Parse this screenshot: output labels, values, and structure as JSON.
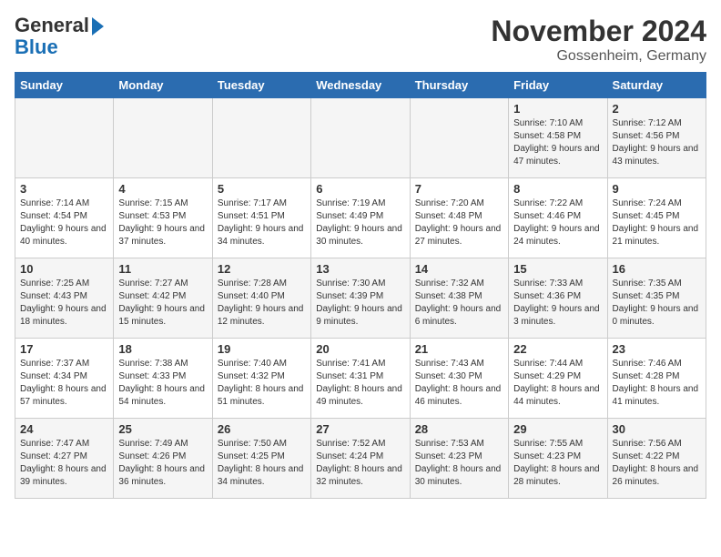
{
  "logo": {
    "line1": "General",
    "line2": "Blue"
  },
  "title": "November 2024",
  "location": "Gossenheim, Germany",
  "weekdays": [
    "Sunday",
    "Monday",
    "Tuesday",
    "Wednesday",
    "Thursday",
    "Friday",
    "Saturday"
  ],
  "weeks": [
    [
      {
        "day": "",
        "info": ""
      },
      {
        "day": "",
        "info": ""
      },
      {
        "day": "",
        "info": ""
      },
      {
        "day": "",
        "info": ""
      },
      {
        "day": "",
        "info": ""
      },
      {
        "day": "1",
        "info": "Sunrise: 7:10 AM\nSunset: 4:58 PM\nDaylight: 9 hours and 47 minutes."
      },
      {
        "day": "2",
        "info": "Sunrise: 7:12 AM\nSunset: 4:56 PM\nDaylight: 9 hours and 43 minutes."
      }
    ],
    [
      {
        "day": "3",
        "info": "Sunrise: 7:14 AM\nSunset: 4:54 PM\nDaylight: 9 hours and 40 minutes."
      },
      {
        "day": "4",
        "info": "Sunrise: 7:15 AM\nSunset: 4:53 PM\nDaylight: 9 hours and 37 minutes."
      },
      {
        "day": "5",
        "info": "Sunrise: 7:17 AM\nSunset: 4:51 PM\nDaylight: 9 hours and 34 minutes."
      },
      {
        "day": "6",
        "info": "Sunrise: 7:19 AM\nSunset: 4:49 PM\nDaylight: 9 hours and 30 minutes."
      },
      {
        "day": "7",
        "info": "Sunrise: 7:20 AM\nSunset: 4:48 PM\nDaylight: 9 hours and 27 minutes."
      },
      {
        "day": "8",
        "info": "Sunrise: 7:22 AM\nSunset: 4:46 PM\nDaylight: 9 hours and 24 minutes."
      },
      {
        "day": "9",
        "info": "Sunrise: 7:24 AM\nSunset: 4:45 PM\nDaylight: 9 hours and 21 minutes."
      }
    ],
    [
      {
        "day": "10",
        "info": "Sunrise: 7:25 AM\nSunset: 4:43 PM\nDaylight: 9 hours and 18 minutes."
      },
      {
        "day": "11",
        "info": "Sunrise: 7:27 AM\nSunset: 4:42 PM\nDaylight: 9 hours and 15 minutes."
      },
      {
        "day": "12",
        "info": "Sunrise: 7:28 AM\nSunset: 4:40 PM\nDaylight: 9 hours and 12 minutes."
      },
      {
        "day": "13",
        "info": "Sunrise: 7:30 AM\nSunset: 4:39 PM\nDaylight: 9 hours and 9 minutes."
      },
      {
        "day": "14",
        "info": "Sunrise: 7:32 AM\nSunset: 4:38 PM\nDaylight: 9 hours and 6 minutes."
      },
      {
        "day": "15",
        "info": "Sunrise: 7:33 AM\nSunset: 4:36 PM\nDaylight: 9 hours and 3 minutes."
      },
      {
        "day": "16",
        "info": "Sunrise: 7:35 AM\nSunset: 4:35 PM\nDaylight: 9 hours and 0 minutes."
      }
    ],
    [
      {
        "day": "17",
        "info": "Sunrise: 7:37 AM\nSunset: 4:34 PM\nDaylight: 8 hours and 57 minutes."
      },
      {
        "day": "18",
        "info": "Sunrise: 7:38 AM\nSunset: 4:33 PM\nDaylight: 8 hours and 54 minutes."
      },
      {
        "day": "19",
        "info": "Sunrise: 7:40 AM\nSunset: 4:32 PM\nDaylight: 8 hours and 51 minutes."
      },
      {
        "day": "20",
        "info": "Sunrise: 7:41 AM\nSunset: 4:31 PM\nDaylight: 8 hours and 49 minutes."
      },
      {
        "day": "21",
        "info": "Sunrise: 7:43 AM\nSunset: 4:30 PM\nDaylight: 8 hours and 46 minutes."
      },
      {
        "day": "22",
        "info": "Sunrise: 7:44 AM\nSunset: 4:29 PM\nDaylight: 8 hours and 44 minutes."
      },
      {
        "day": "23",
        "info": "Sunrise: 7:46 AM\nSunset: 4:28 PM\nDaylight: 8 hours and 41 minutes."
      }
    ],
    [
      {
        "day": "24",
        "info": "Sunrise: 7:47 AM\nSunset: 4:27 PM\nDaylight: 8 hours and 39 minutes."
      },
      {
        "day": "25",
        "info": "Sunrise: 7:49 AM\nSunset: 4:26 PM\nDaylight: 8 hours and 36 minutes."
      },
      {
        "day": "26",
        "info": "Sunrise: 7:50 AM\nSunset: 4:25 PM\nDaylight: 8 hours and 34 minutes."
      },
      {
        "day": "27",
        "info": "Sunrise: 7:52 AM\nSunset: 4:24 PM\nDaylight: 8 hours and 32 minutes."
      },
      {
        "day": "28",
        "info": "Sunrise: 7:53 AM\nSunset: 4:23 PM\nDaylight: 8 hours and 30 minutes."
      },
      {
        "day": "29",
        "info": "Sunrise: 7:55 AM\nSunset: 4:23 PM\nDaylight: 8 hours and 28 minutes."
      },
      {
        "day": "30",
        "info": "Sunrise: 7:56 AM\nSunset: 4:22 PM\nDaylight: 8 hours and 26 minutes."
      }
    ]
  ]
}
